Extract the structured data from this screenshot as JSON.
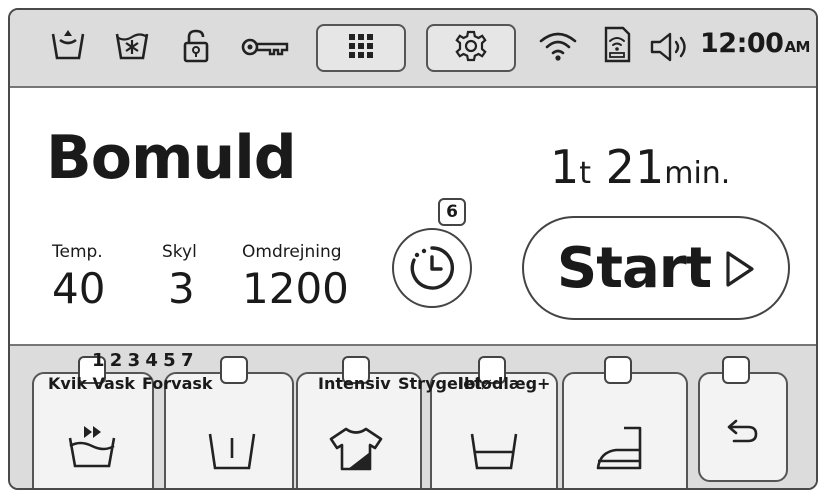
{
  "status_bar": {
    "icons": [
      "wash-tub-icon",
      "cold-wash-icon",
      "child-lock-icon",
      "key-icon",
      "apps-grid-icon",
      "settings-gear-icon",
      "wifi-icon",
      "smart-control-icon",
      "volume-icon"
    ],
    "clock_time": "12:00",
    "clock_ampm": "AM"
  },
  "program": {
    "name": "Bomuld",
    "time_hours": "1",
    "time_hours_unit": "t",
    "time_minutes": "21",
    "time_minutes_unit": "min."
  },
  "params": [
    {
      "label": "Temp.",
      "value": "40"
    },
    {
      "label": "Skyl",
      "value": "3"
    },
    {
      "label": "Omdrejning",
      "value": "1200"
    }
  ],
  "delay_timer": {
    "badge": "6",
    "icon": "delay-timer-icon"
  },
  "start": {
    "label": "Start",
    "icon": "play-triangle-icon"
  },
  "option_digits": "1 2 3 4 5 7",
  "options": [
    {
      "label": "Kvik Vask",
      "icon": "quick-wash-icon"
    },
    {
      "label": "Forvask",
      "icon": "prewash-icon"
    },
    {
      "label": "Intensiv",
      "icon": "intensive-shirt-icon"
    },
    {
      "label": "Strygelet",
      "icon": "soak-icon"
    },
    {
      "label": "Iblødlæg+",
      "icon": "soak-icon"
    },
    {
      "label": "",
      "icon": "iron-icon"
    },
    {
      "label": "",
      "icon": "back-arrow-icon"
    }
  ],
  "colors": {
    "bar_bg": "#dcdcdc",
    "border": "#555555",
    "text": "#1a1a1a"
  }
}
